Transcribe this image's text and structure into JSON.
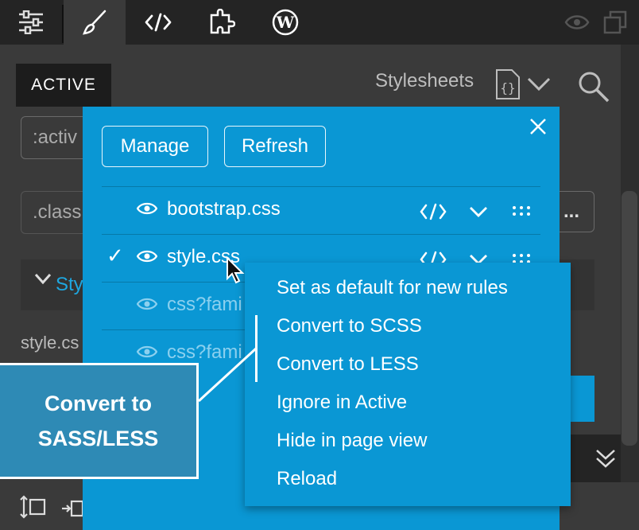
{
  "toolbar": {
    "icons": [
      "sliders-icon",
      "brush-icon",
      "code-icon",
      "puzzle-icon",
      "wordpress-icon",
      "eye-icon",
      "window-icon"
    ]
  },
  "header": {
    "active_tab": "ACTIVE",
    "stylesheets_label": "Stylesheets"
  },
  "background": {
    "selector_input": ":activ",
    "class_input": ".class",
    "more_button": "...",
    "style_section": "Sty",
    "file_label": "style.cs"
  },
  "panel": {
    "manage_button": "Manage",
    "refresh_button": "Refresh",
    "sheets": [
      {
        "name": "bootstrap.css",
        "checked": false,
        "dim": false
      },
      {
        "name": "style.css",
        "checked": true,
        "dim": false
      },
      {
        "name": "css?fami",
        "checked": false,
        "dim": true
      },
      {
        "name": "css?fami",
        "checked": false,
        "dim": true
      }
    ],
    "check_glyph": "✓"
  },
  "context_menu": {
    "items": [
      "Set as default for new rules",
      "Convert to SCSS",
      "Convert to LESS",
      "Ignore in Active",
      "Hide in page view",
      "Reload"
    ]
  },
  "callout": {
    "line1": "Convert to",
    "line2": "SASS/LESS"
  },
  "colors": {
    "panel_blue": "#0a97d4",
    "callout_blue": "#2e8ab5",
    "toolbar_dark": "#242424"
  }
}
